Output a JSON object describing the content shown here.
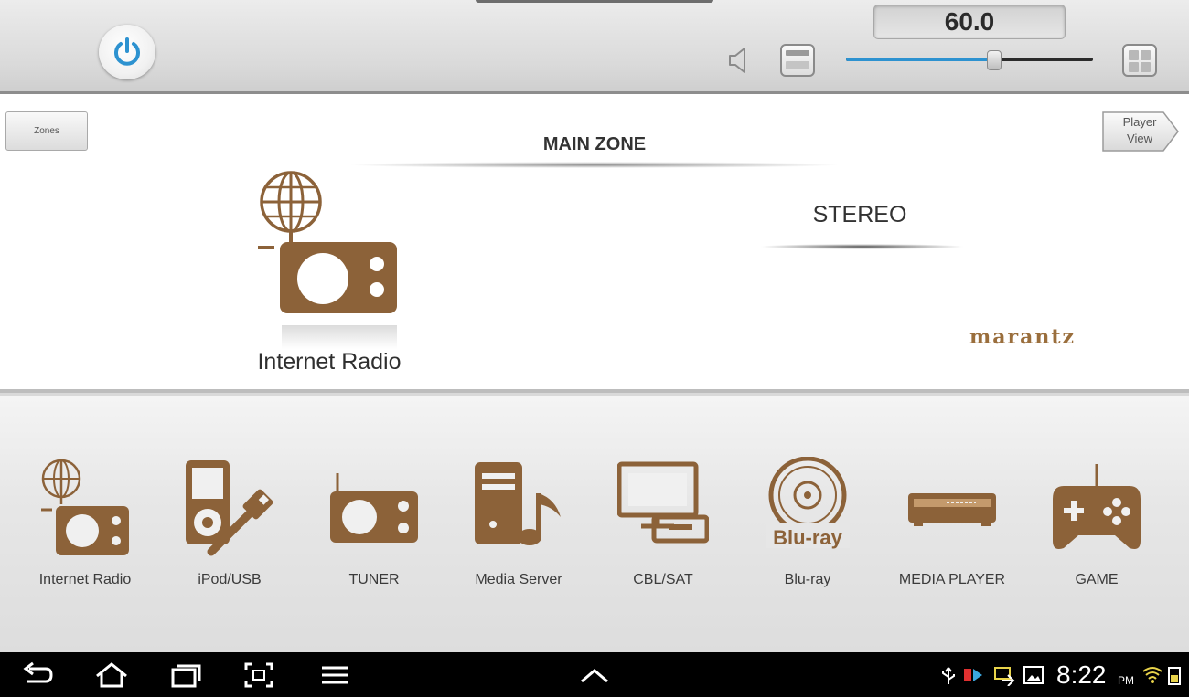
{
  "top_bar": {
    "power": {
      "icon": "power-icon",
      "color": "#2d92d0"
    },
    "volume_value": "60.0",
    "volume_level_fraction": 0.6,
    "mute_icon": "speaker-icon",
    "volume_down_icon": "volume-down-icon",
    "volume_up_icon": "volume-up-icon"
  },
  "main_zone": {
    "zones_label": "Zones",
    "title": "MAIN ZONE",
    "player_view_line1": "Player",
    "player_view_line2": "View",
    "current_source": "Internet Radio",
    "surround_mode": "STEREO",
    "brand": "marantz",
    "brand_color": "#9a6e3c",
    "icon_color": "#8c6239"
  },
  "sources": [
    {
      "label": "Internet Radio",
      "icon": "internet-radio-icon"
    },
    {
      "label": "iPod/USB",
      "icon": "ipod-usb-icon"
    },
    {
      "label": "TUNER",
      "icon": "tuner-icon"
    },
    {
      "label": "Media Server",
      "icon": "media-server-icon"
    },
    {
      "label": "CBL/SAT",
      "icon": "cbl-sat-icon"
    },
    {
      "label": "Blu-ray",
      "icon": "blu-ray-icon",
      "icon_text": "Blu-ray"
    },
    {
      "label": "MEDIA PLAYER",
      "icon": "media-player-icon"
    },
    {
      "label": "GAME",
      "icon": "game-icon"
    }
  ],
  "system_bar": {
    "time": "8:22",
    "ampm": "PM",
    "nav_icons": [
      "back-icon",
      "home-icon",
      "recent-apps-icon",
      "screenshot-icon",
      "menu-icon",
      "up-chevron-icon"
    ],
    "status_icons": [
      "usb-icon",
      "notification-icon",
      "cast-icon",
      "gallery-icon",
      "wifi-icon"
    ]
  }
}
